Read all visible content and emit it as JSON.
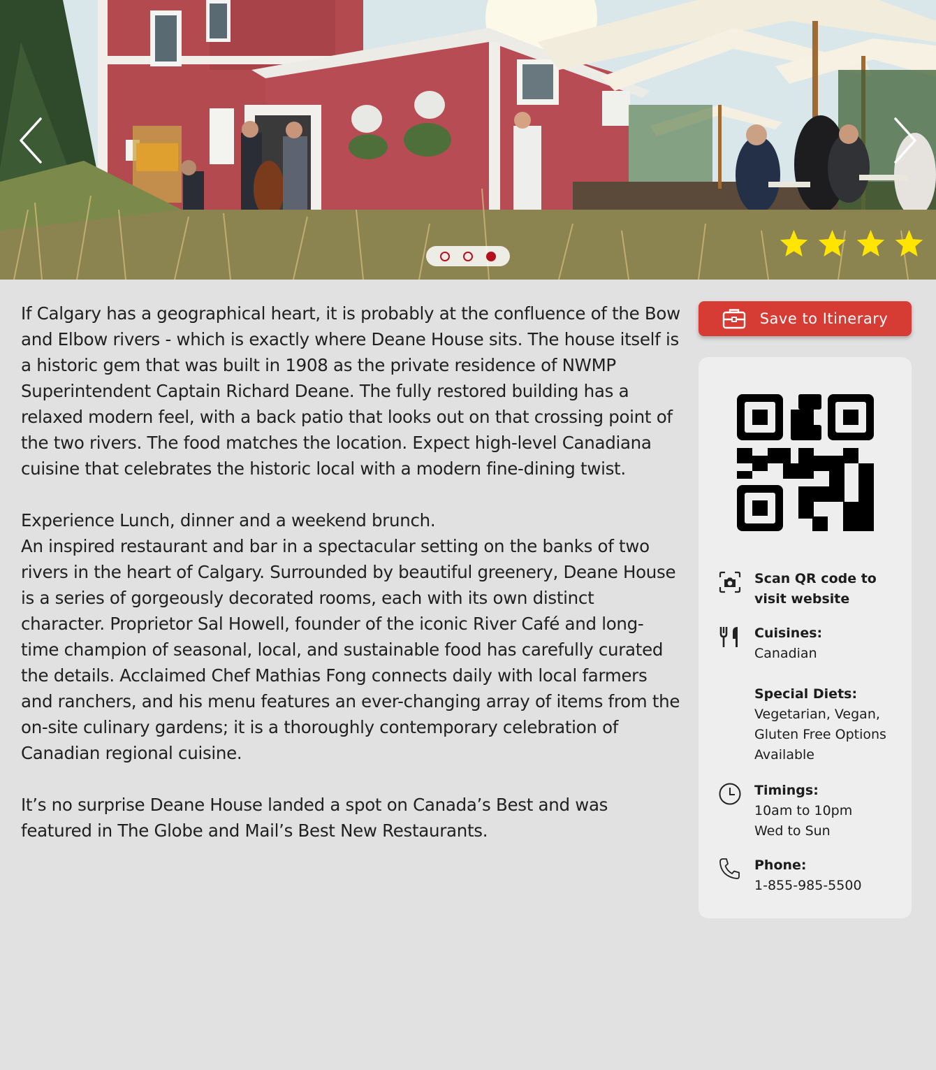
{
  "hero": {
    "prev_icon": "chevron-left-icon",
    "next_icon": "chevron-right-icon",
    "slides": 3,
    "active_slide": 3,
    "rating": 4,
    "rating_max": 4,
    "star_color": "#ffe500"
  },
  "description": {
    "paragraph1": "If Calgary has a geographical heart, it is probably at the confluence of the Bow and Elbow rivers - which is exactly where Deane House sits. The house itself is a historic gem that was built in 1908 as the private residence of NWMP Superintendent Captain Richard Deane. The fully restored building has a relaxed modern feel, with a back patio that looks out on that crossing point of the two rivers. The food matches the location. Expect high-level Canadiana cuisine that celebrates the historic local with a modern fine-dining twist.",
    "paragraph2_line1": "Experience Lunch, dinner and a weekend brunch.",
    "paragraph2_body": "An inspired restaurant and bar in a spectacular setting on the banks of two rivers in the heart of Calgary. Surrounded by beautiful greenery, Deane House is a series of gorgeously decorated rooms, each with its own distinct character. Proprietor Sal Howell, founder of the iconic River Café and long-time champion of seasonal, local, and sustainable food has carefully curated the details. Acclaimed Chef Mathias Fong connects daily with local farmers and ranchers, and his menu features an ever-changing array of items from the on-site culinary gardens; it is a thoroughly contemporary celebration of Canadian regional cuisine.",
    "paragraph3": "It’s no surprise Deane House landed a spot on Canada’s Best and was featured in The Globe and Mail’s Best New Restaurants."
  },
  "sidebar": {
    "save_button": {
      "label": "Save to Itinerary",
      "icon": "briefcase-icon",
      "color": "#d63c34"
    },
    "qr": {
      "label": "Scan QR code to visit website",
      "icon": "camera-scan-icon"
    },
    "cuisines": {
      "label": "Cuisines:",
      "value": "Canadian",
      "icon": "fork-knife-icon"
    },
    "special_diets": {
      "label": "Special Diets:",
      "value": "Vegetarian, Vegan, Gluten Free Options Available"
    },
    "timings": {
      "label": "Timings:",
      "hours": "10am to 10pm",
      "days": "Wed to Sun",
      "icon": "clock-icon"
    },
    "phone": {
      "label": "Phone:",
      "value": "1-855-985-5500",
      "icon": "phone-icon"
    }
  }
}
